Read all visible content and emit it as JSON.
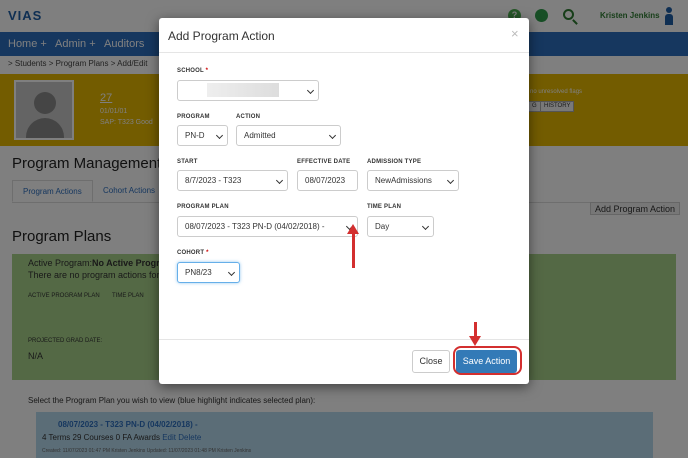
{
  "app": {
    "logo": "VIAS"
  },
  "top": {
    "user_name": "Kristen Jenkins",
    "help_icon": "?"
  },
  "nav": {
    "items": [
      "Home +",
      "Admin +",
      "Auditors"
    ]
  },
  "breadcrumb": "> Students  > Program Plans  > Add/Edit",
  "student": {
    "id": "27",
    "dob": "01/01/01",
    "sap": "SAP: T323  Good"
  },
  "banner": {
    "flags_text": "no unresolved flags",
    "buttons": [
      "G",
      "HISTORY"
    ]
  },
  "program_management": {
    "title": "Program Management",
    "tabs": [
      "Program Actions",
      "Cohort Actions"
    ],
    "add_action": "Add Program Action"
  },
  "program_plans": {
    "title": "Program Plans",
    "active_program_label": "Active Program:",
    "active_program_value": "No Active Progr",
    "no_actions": "There are no program actions for",
    "active_program_plan": "ACTIVE PROGRAM PLAN",
    "time_plan": "TIME PLAN",
    "projected_grad": "PROJECTED GRAD DATE:",
    "na": "N/A"
  },
  "plan_list": {
    "instruction": "Select the Program Plan you wish to view (blue highlight indicates selected plan):",
    "plan_title": "08/07/2023 - T323 PN-D (04/02/2018) -",
    "plan_summary": "4 Terms 29 Courses 0 FA Awards",
    "edit": "Edit",
    "delete": "Delete",
    "created": "Created: 11/07/2023 01:47 PM Kristen Jenkins     Updated: 11/07/2023 01:48 PM Kristen Jenkins"
  },
  "modal": {
    "title": "Add Program Action",
    "close_symbol": "×",
    "school": {
      "label": "SCHOOL",
      "required": "*",
      "value": ""
    },
    "program": {
      "label": "PROGRAM",
      "value": "PN-D"
    },
    "action": {
      "label": "ACTION",
      "value": "Admitted"
    },
    "start": {
      "label": "START",
      "value": "8/7/2023 - T323"
    },
    "effective_date": {
      "label": "EFFECTIVE DATE",
      "value": "08/07/2023"
    },
    "admission_type": {
      "label": "ADMISSION TYPE",
      "value": "NewAdmissions"
    },
    "program_plan": {
      "label": "PROGRAM PLAN",
      "value": "08/07/2023 - T323 PN-D (04/02/2018) -"
    },
    "time_plan": {
      "label": "TIME PLAN",
      "value": "Day"
    },
    "cohort": {
      "label": "COHORT",
      "required": "*",
      "value": "PN8/23"
    },
    "close_button": "Close",
    "save_button": "Save Action"
  },
  "colors": {
    "nav": "#2d6fbf",
    "banner": "#e6b800",
    "panel": "#a8d38a",
    "primary": "#337ab7",
    "annotation": "#d32f2f"
  }
}
